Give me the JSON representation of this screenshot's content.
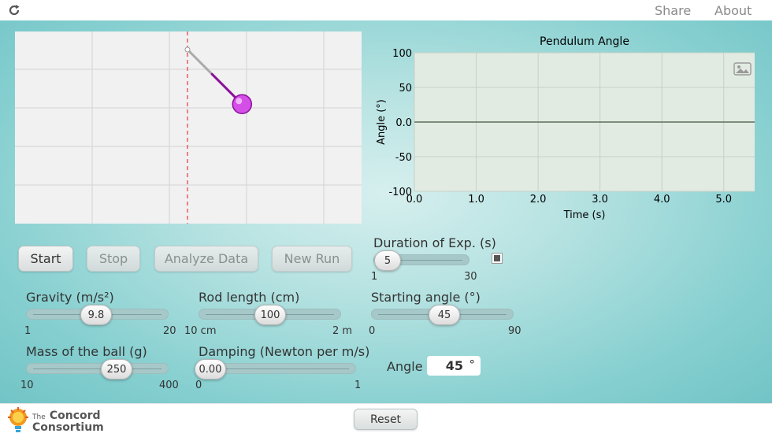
{
  "topbar": {
    "share_label": "Share",
    "about_label": "About",
    "reload_icon": "reload-icon"
  },
  "pendulum": {
    "angle_deg": 45,
    "colors": {
      "rod_inner": "#aaaaaa",
      "rod_outer": "#8a109a",
      "bob": "#d44ee8",
      "pivot_line": "#e5484d"
    }
  },
  "buttons": {
    "start": "Start",
    "stop": "Stop",
    "analyze": "Analyze Data",
    "new_run": "New Run",
    "reset": "Reset"
  },
  "sliders": {
    "gravity": {
      "label": "Gravity (m/s²)",
      "value": "9.8",
      "min": "1",
      "max": "20"
    },
    "rod_length": {
      "label": "Rod length (cm)",
      "value": "100",
      "min": "10 cm",
      "max": "2 m"
    },
    "mass": {
      "label": "Mass of the ball (g)",
      "value": "250",
      "min": "10",
      "max": "400"
    },
    "damping": {
      "label": "Damping (Newton per m/s)",
      "value": "0.00",
      "min": "0",
      "max": "1"
    },
    "duration": {
      "label": "Duration of Exp. (s)",
      "value": "5",
      "min": "1",
      "max": "30"
    },
    "start_angle": {
      "label": "Starting angle (°)",
      "value": "45",
      "min": "0",
      "max": "90"
    }
  },
  "angle_readout": {
    "label": "Angle",
    "value": "45",
    "unit": "°"
  },
  "footer": {
    "logo_small": "The",
    "logo_line1": "Concord",
    "logo_line2": "Consortium"
  },
  "chart_data": {
    "type": "line",
    "title": "Pendulum Angle",
    "xlabel": "Time (s)",
    "ylabel": "Angle (°)",
    "xlim": [
      0,
      5.5
    ],
    "ylim": [
      -100,
      100
    ],
    "x_ticks": [
      "0.0",
      "1.0",
      "2.0",
      "3.0",
      "4.0",
      "5.0"
    ],
    "y_ticks": [
      "100",
      "50",
      "0.0",
      "-50",
      "-100"
    ],
    "grid": true,
    "series": [],
    "zero_line": true
  }
}
